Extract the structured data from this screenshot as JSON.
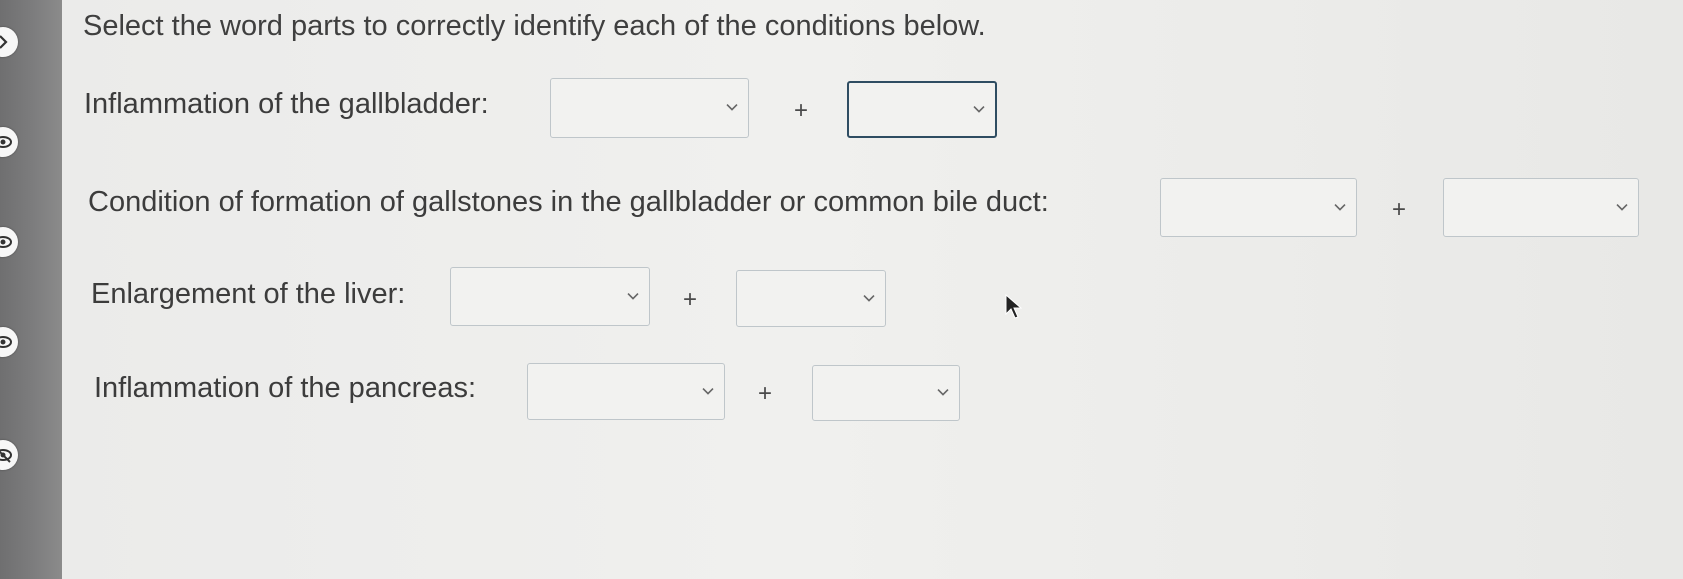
{
  "instruction": "Select the word parts to correctly identify each of the conditions below.",
  "questions": [
    {
      "label": "Inflammation of the gallbladder:",
      "dropdowns": [
        {
          "value": ""
        },
        {
          "value": ""
        }
      ],
      "separator": "+"
    },
    {
      "label": "Condition of formation of gallstones in the gallbladder or common bile duct:",
      "dropdowns": [
        {
          "value": ""
        },
        {
          "value": ""
        }
      ],
      "separator": "+"
    },
    {
      "label": "Enlargement of the liver:",
      "dropdowns": [
        {
          "value": ""
        },
        {
          "value": ""
        }
      ],
      "separator": "+"
    },
    {
      "label": "Inflammation of the pancreas:",
      "dropdowns": [
        {
          "value": ""
        },
        {
          "value": ""
        }
      ],
      "separator": "+"
    }
  ],
  "colors": {
    "active_border": "#2f4d62",
    "dropdown_border": "#bfc6ca",
    "background": "#ececea",
    "sidebar": "#7a7a7b"
  },
  "icons": {
    "rail": [
      "chevron-right-icon",
      "eye-icon",
      "eye-icon",
      "eye-icon",
      "eye-off-icon"
    ],
    "dropdown": "chevron-down-icon",
    "cursor": "mouse-pointer-icon"
  }
}
